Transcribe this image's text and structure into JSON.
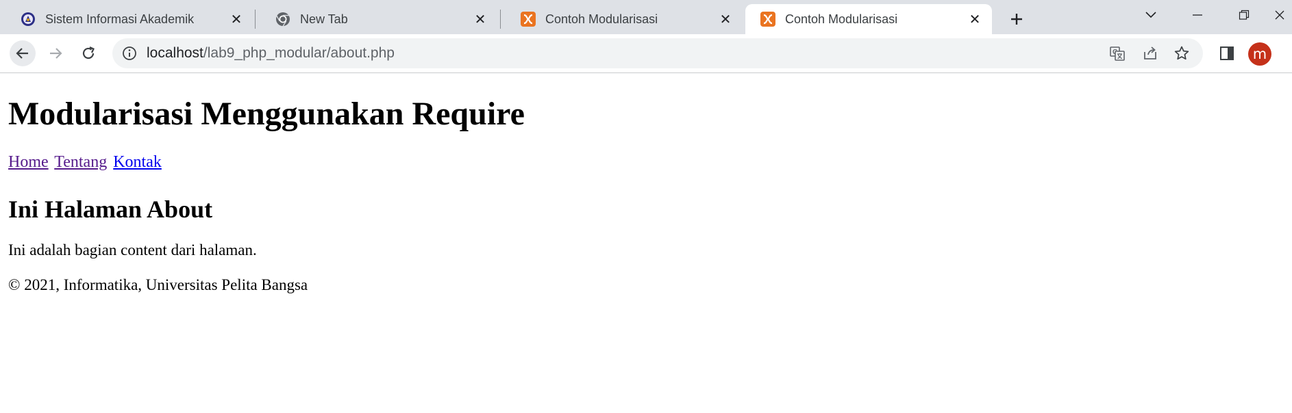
{
  "browser": {
    "tabs": [
      {
        "title": "Sistem Informasi Akademik",
        "favicon": "university-crest-icon"
      },
      {
        "title": "New Tab",
        "favicon": "chrome-icon"
      },
      {
        "title": "Contoh Modularisasi",
        "favicon": "xampp-icon"
      },
      {
        "title": "Contoh Modularisasi",
        "favicon": "xampp-icon",
        "active": true
      }
    ],
    "url_host": "localhost",
    "url_path": "/lab9_php_modular/about.php",
    "profile_initial": "m",
    "colors": {
      "tabstrip": "#dee1e6",
      "xampp": "#ea7421",
      "profile": "#c5311a"
    }
  },
  "page": {
    "title": "Modularisasi Menggunakan Require",
    "nav": {
      "home": "Home",
      "about": "Tentang",
      "contact": "Kontak"
    },
    "heading": "Ini Halaman About",
    "content": "Ini adalah bagian content dari halaman.",
    "footer": "© 2021, Informatika, Universitas Pelita Bangsa"
  }
}
